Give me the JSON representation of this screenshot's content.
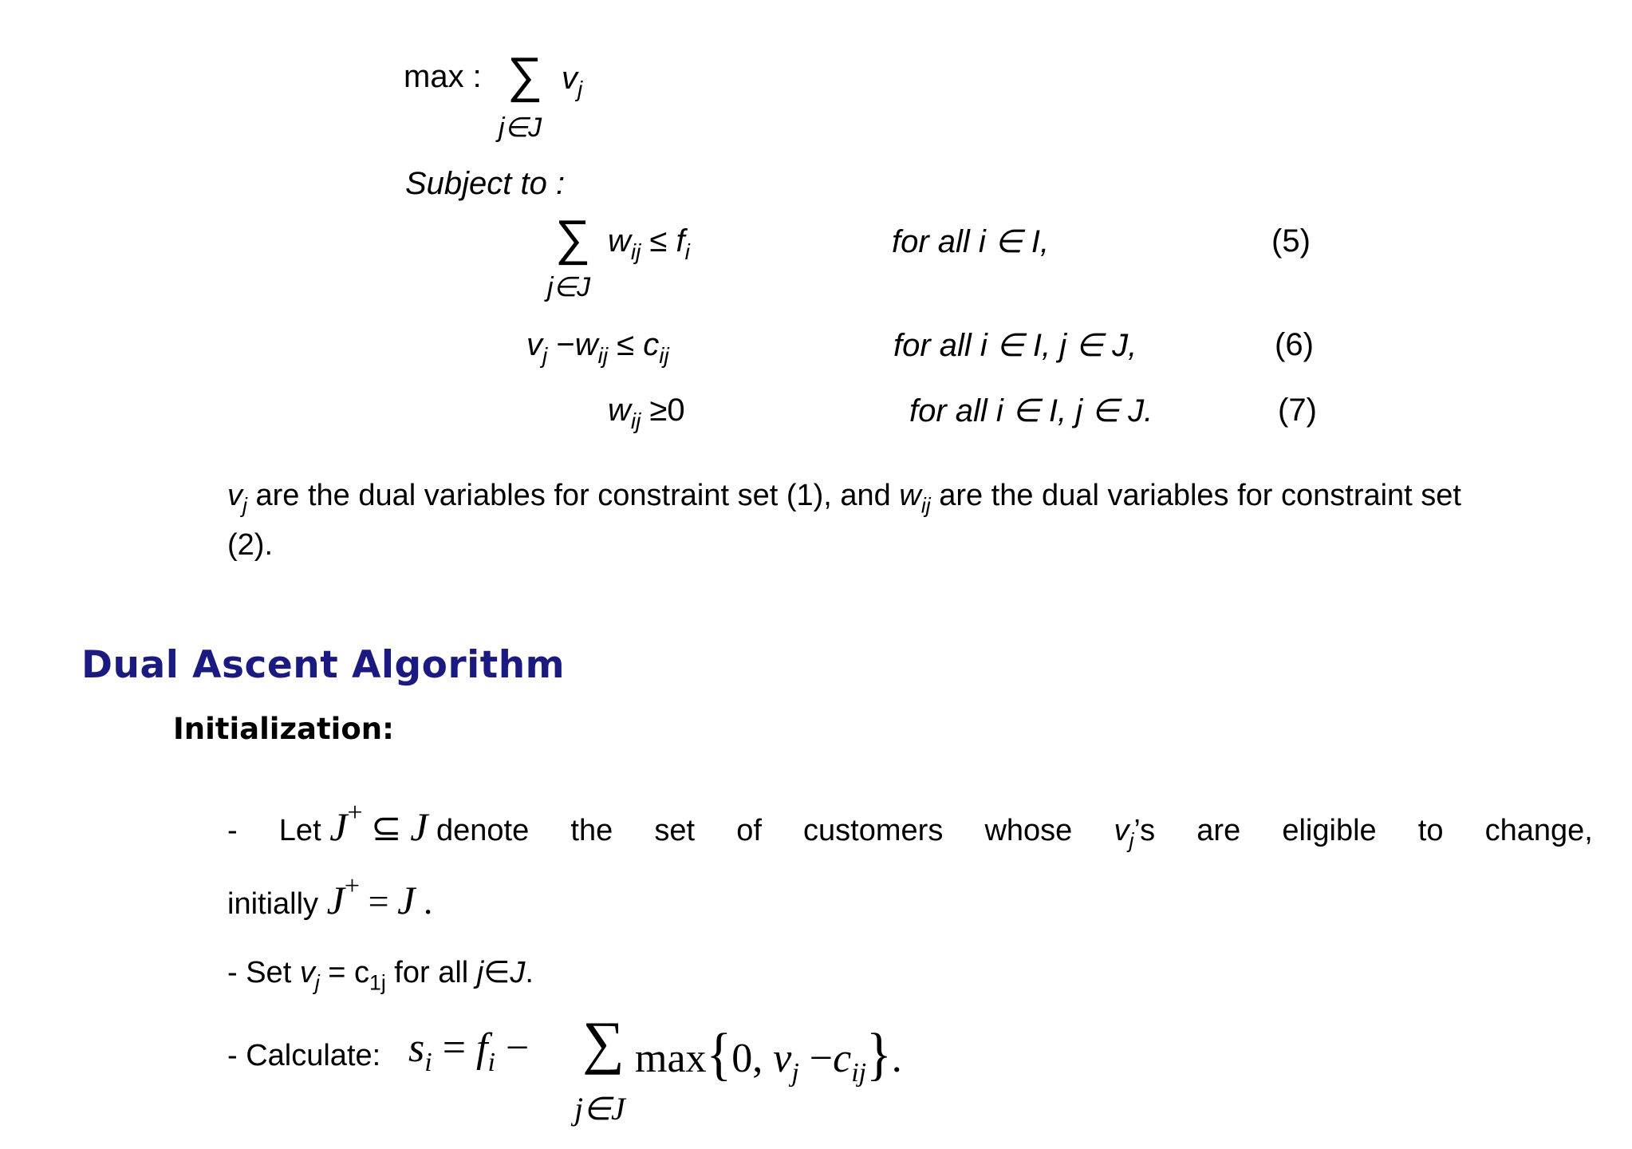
{
  "objective": {
    "label": "max :",
    "sigma": "∑",
    "term_var": "v",
    "term_sub": "j",
    "below": "j∈J"
  },
  "subject_to": "Subject to :",
  "constraints": [
    {
      "sigma": "∑",
      "below": "j∈J",
      "lhs_var": "w",
      "lhs_sub": "ij",
      "relation": "≤",
      "rhs_var": "f",
      "rhs_sub": "i",
      "condition": "for all i ∈ I,",
      "number": "(5)"
    },
    {
      "lhs_var1": "v",
      "lhs_sub1": "j",
      "minus": "−",
      "lhs_var2": "w",
      "lhs_sub2": "ij",
      "relation": "≤",
      "rhs_var": "c",
      "rhs_sub": "ij",
      "condition": "for all i ∈ I, j ∈ J,",
      "number": "(6)"
    },
    {
      "lhs_var": "w",
      "lhs_sub": "ij",
      "relation": "≥",
      "rhs": "0",
      "condition": "for all i ∈ I, j ∈ J.",
      "number": "(7)"
    }
  ],
  "explanation": {
    "v": "v",
    "v_sub": "j",
    "part1": " are the dual variables for constraint set (1), and ",
    "w": "w",
    "w_sub": "ij",
    "part2": " are the dual variables for constraint set",
    "line2": "(2)."
  },
  "section": {
    "heading": "Dual Ascent Algorithm",
    "subheading": "Initialization:"
  },
  "steps": {
    "step1": {
      "dash": "-",
      "let": "Let",
      "J": "J",
      "plus": "+",
      "subseteq": "⊆",
      "J2": "J",
      "words": [
        "denote",
        "the",
        "set",
        "of",
        "customers",
        "whose"
      ],
      "vj": "v",
      "vj_sub": "j",
      "vj_suffix": "’s",
      "words2": [
        "are",
        "eligible",
        "to",
        "change,"
      ],
      "line2_text": "initially",
      "line2_J": "J",
      "line2_plus": "+",
      "line2_eq": "=",
      "line2_J2": "J",
      "line2_end": "."
    },
    "step2": {
      "prefix": "- Set ",
      "v": "v",
      "v_sub": "j",
      "eq": " = c",
      "c_sub": "1j",
      "suffix": " for all ",
      "j": "j",
      "in": "∈",
      "J": "J",
      "end": "."
    },
    "step3": {
      "prefix": "- Calculate:",
      "s": "s",
      "s_sub": "i",
      "eq": "=",
      "f": "f",
      "f_sub": "i",
      "minus": "−",
      "sigma": "∑",
      "below": "j∈J",
      "max": "max",
      "lbrace": "{",
      "zero": "0,",
      "v": "v",
      "v_sub": "j",
      "minus2": "−",
      "c": "c",
      "c_sub": "ij",
      "rbrace": "}",
      "end": "."
    }
  }
}
